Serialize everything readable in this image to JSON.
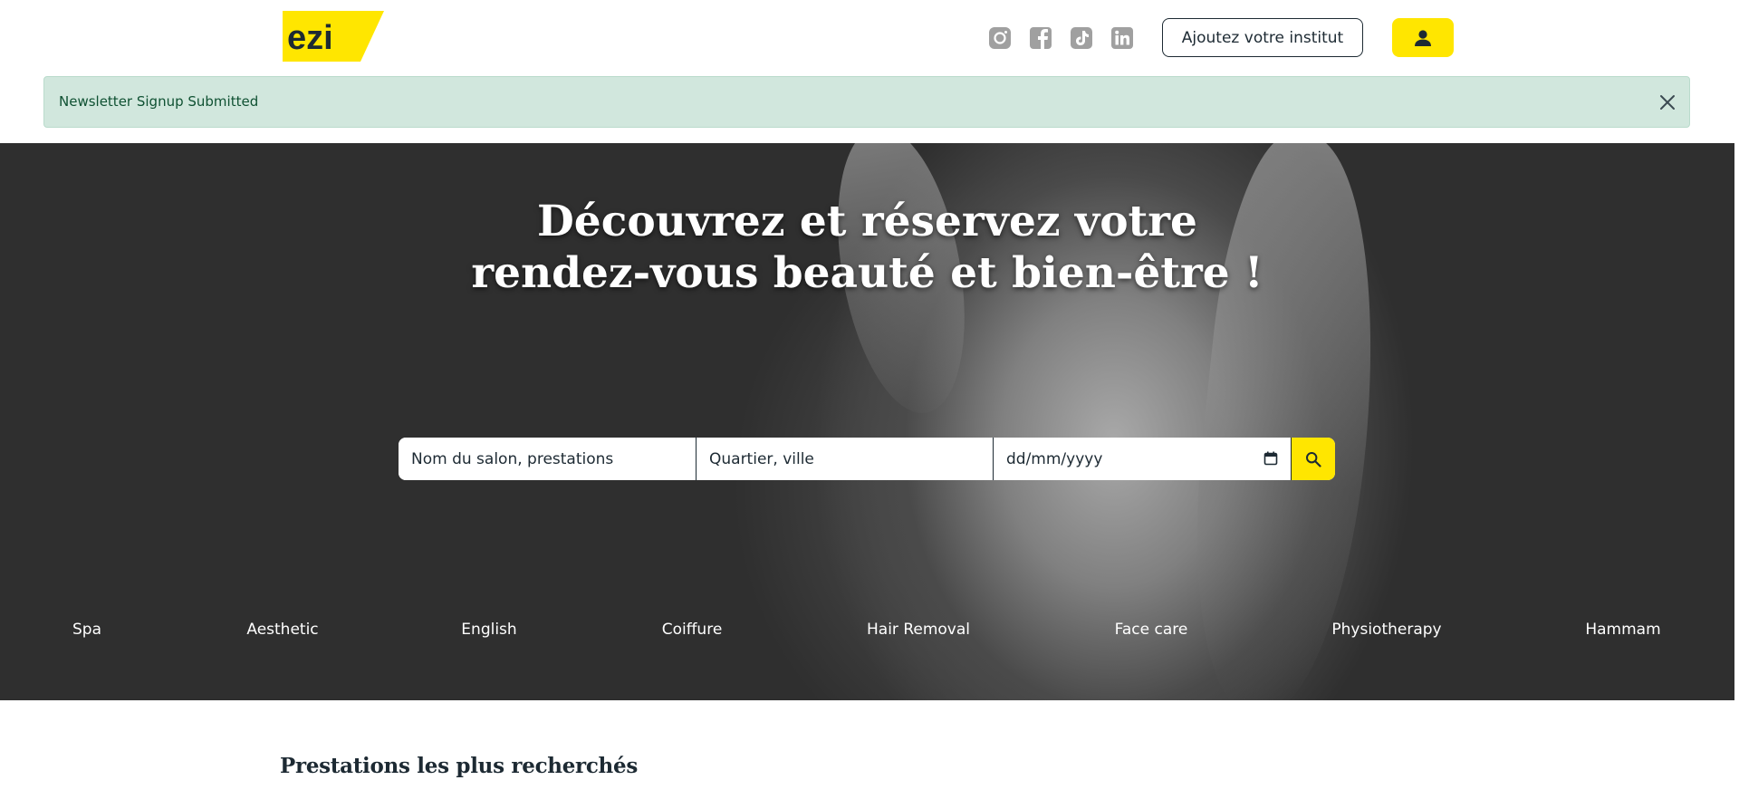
{
  "header": {
    "logo_text": "ezi",
    "social": [
      "instagram-icon",
      "facebook-icon",
      "tiktok-icon",
      "linkedin-icon"
    ],
    "add_institute_label": "Ajoutez votre institut",
    "user_icon": "user-icon"
  },
  "alert": {
    "message": "Newsletter Signup Submitted",
    "close_icon": "close-icon"
  },
  "hero": {
    "title_line1": "Découvrez et réservez votre",
    "title_line2": "rendez-vous beauté et bien-être !",
    "search": {
      "salon_placeholder": "Nom du salon, prestations",
      "location_placeholder": "Quartier, ville",
      "date_placeholder": "dd/mm/yyyy",
      "search_icon": "search-icon"
    },
    "categories": [
      "Spa",
      "Aesthetic",
      "English",
      "Coiffure",
      "Hair Removal",
      "Face care",
      "Physiotherapy",
      "Hammam"
    ]
  },
  "section": {
    "title": "Prestations les plus recherchés"
  },
  "colors": {
    "brand_yellow": "#ffe600",
    "ink": "#1d2a33",
    "alert_bg": "#d1e7dd",
    "alert_text": "#0f5132"
  }
}
